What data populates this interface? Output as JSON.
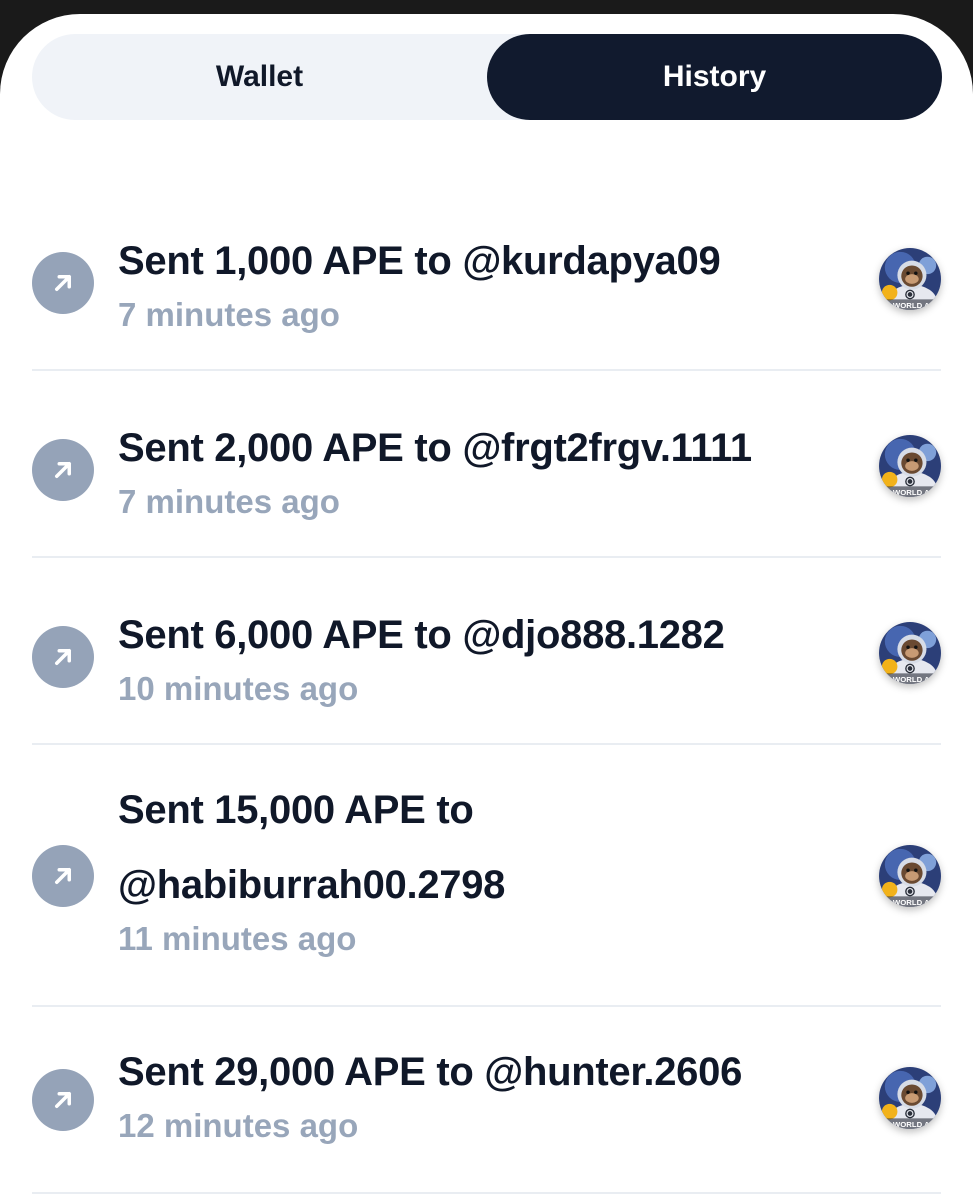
{
  "tabs": {
    "wallet": "Wallet",
    "history": "History",
    "active": "History"
  },
  "avatar_text": "WORLD AP",
  "transactions": [
    {
      "title_line1": "Sent 1,000 APE to @kurdapya09",
      "title_line2": "",
      "time": "7 minutes ago"
    },
    {
      "title_line1": "Sent 2,000 APE to @frgt2frgv.1111",
      "title_line2": "",
      "time": "7 minutes ago"
    },
    {
      "title_line1": "Sent 6,000 APE to @djo888.1282",
      "title_line2": "",
      "time": "10 minutes ago"
    },
    {
      "title_line1": "Sent 15,000 APE to",
      "title_line2": "@habiburrah00.2798",
      "time": "11 minutes ago"
    },
    {
      "title_line1": "Sent 29,000 APE to @hunter.2606",
      "title_line2": "",
      "time": "12 minutes ago"
    }
  ],
  "colors": {
    "active_tab": "#111a2e",
    "inactive_tab_bg": "#f0f3f8",
    "arrow_badge": "#95a3b8",
    "title_text": "#101829",
    "time_text": "#98a6ba"
  }
}
